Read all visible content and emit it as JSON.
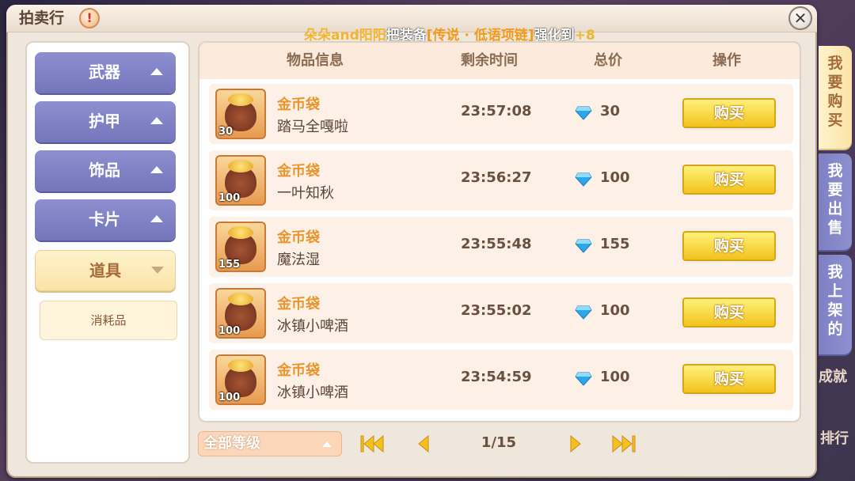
{
  "window": {
    "title": "拍卖行",
    "info_icon": "exclamation-icon",
    "close_icon": "close-icon"
  },
  "ticker": {
    "player": "朵朵and阳阳",
    "text1": "把装备",
    "item": "[传说 · 低语项链]",
    "text2": "强化到",
    "level": "+8"
  },
  "categories": [
    {
      "label": "武器",
      "expanded": false
    },
    {
      "label": "护甲",
      "expanded": false
    },
    {
      "label": "饰品",
      "expanded": false
    },
    {
      "label": "卡片",
      "expanded": false
    },
    {
      "label": "道具",
      "expanded": true
    }
  ],
  "subcategory": {
    "label": "消耗品"
  },
  "table": {
    "headers": {
      "info": "物品信息",
      "time": "剩余时间",
      "price": "总价",
      "action": "操作"
    },
    "rows": [
      {
        "name": "金币袋",
        "seller": "踏马全嘎啦",
        "qty": "30",
        "time": "23:57:08",
        "price": "30",
        "action": "购买"
      },
      {
        "name": "金币袋",
        "seller": "一叶知秋",
        "qty": "100",
        "time": "23:56:27",
        "price": "100",
        "action": "购买"
      },
      {
        "name": "金币袋",
        "seller": "魔法湿",
        "qty": "155",
        "time": "23:55:48",
        "price": "155",
        "action": "购买"
      },
      {
        "name": "金币袋",
        "seller": "冰镇小啤酒",
        "qty": "100",
        "time": "23:55:02",
        "price": "100",
        "action": "购买"
      },
      {
        "name": "金币袋",
        "seller": "冰镇小啤酒",
        "qty": "100",
        "time": "23:54:59",
        "price": "100",
        "action": "购买"
      }
    ]
  },
  "footer": {
    "level_filter": "全部等级",
    "page": "1/15",
    "first_icon": "first-page-icon",
    "prev_icon": "prev-page-icon",
    "next_icon": "next-page-icon",
    "last_icon": "last-page-icon"
  },
  "side_tabs": [
    {
      "label": "我要购买",
      "active": true
    },
    {
      "label": "我要出售",
      "active": false
    },
    {
      "label": "我上架的",
      "active": false
    }
  ],
  "background_labels": {
    "achievement": "成就",
    "rank": "排行"
  },
  "colors": {
    "category": "#8e8fd0",
    "active": "#fbe3a7",
    "buy_button": "#f2c21c",
    "gold_text": "#e8962d",
    "gem": "#2aa8e8"
  }
}
